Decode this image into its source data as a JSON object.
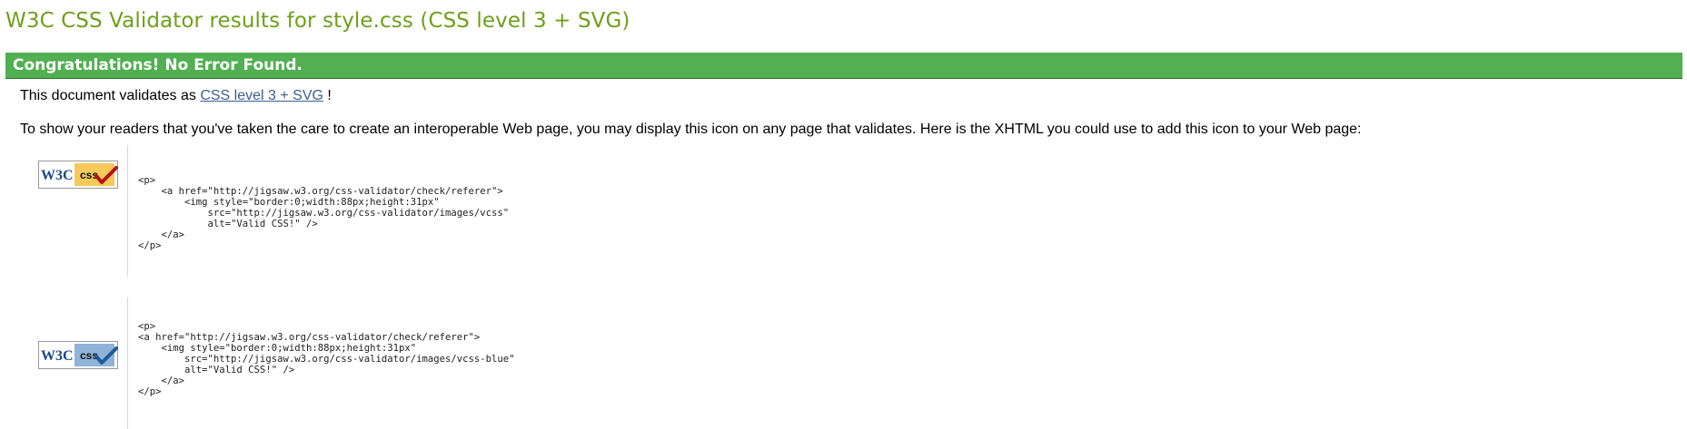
{
  "page": {
    "title": "W3C CSS Validator results for style.css (CSS level 3 + SVG)"
  },
  "banner": {
    "text": "Congratulations! No Error Found."
  },
  "validates": {
    "prefix": "This document validates as ",
    "link": "CSS level 3 + SVG",
    "suffix": " !"
  },
  "info": {
    "text": "To show your readers that you've taken the care to create an interoperable Web page, you may display this icon on any page that validates. Here is the XHTML you could use to add this icon to your Web page:"
  },
  "badges": [
    {
      "w3c_text": "W3C",
      "css_text": "css",
      "color": "#f6c95a",
      "check_color": "#b31414",
      "code": "<p>\n    <a href=\"http://jigsaw.w3.org/css-validator/check/referer\">\n        <img style=\"border:0;width:88px;height:31px\"\n            src=\"http://jigsaw.w3.org/css-validator/images/vcss\"\n            alt=\"Valid CSS!\" />\n    </a>\n</p>"
    },
    {
      "w3c_text": "W3C",
      "css_text": "css",
      "color": "#8fb4d8",
      "check_color": "#1d5a9a",
      "code": "<p>\n<a href=\"http://jigsaw.w3.org/css-validator/check/referer\">\n    <img style=\"border:0;width:88px;height:31px\"\n        src=\"http://jigsaw.w3.org/css-validator/images/vcss-blue\"\n        alt=\"Valid CSS!\" />\n    </a>\n</p>"
    }
  ],
  "colors": {
    "title": "#6f9f1a",
    "banner": "#52af52",
    "link": "#3a5f8f"
  }
}
